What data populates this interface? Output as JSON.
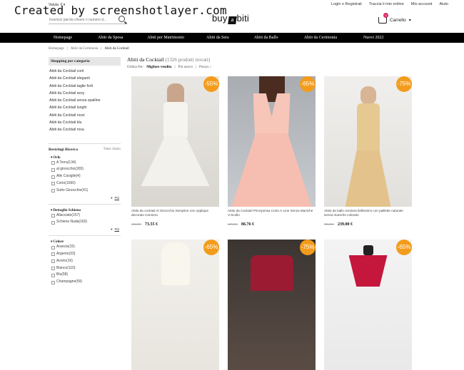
{
  "watermark": "Created by screenshotlayer.com",
  "header": {
    "currency_label": "Valuta: € ▾",
    "search_placeholder": "Inserisci parola chiave o numero d...",
    "logo_pre": "buy",
    "logo_mark": "a",
    "logo_post": "biti",
    "links": [
      "Login o Registrati",
      "Traccia il mio ordine",
      "Mio account",
      "Aiuto"
    ],
    "cart_label": "Carrello",
    "cart_count": "0"
  },
  "nav": [
    "Homepage",
    "Abiti da Sposa",
    "Abiti per Matrimonio",
    "Abiti da Sera",
    "Abiti da Ballo",
    "Abiti da Cerimonia",
    "Nuovi 2022"
  ],
  "breadcrumb": [
    "Homepage",
    "Abiti da Cerimonia",
    "Abiti da Cocktail"
  ],
  "sidebar": {
    "heading": "Shopping per categoria",
    "categories": [
      "Abiti da Cocktail corti",
      "Abiti da Cocktail eleganti",
      "Abiti da Cocktail taglie forti",
      "Abiti da Cocktail sexy",
      "Abiti da Cocktail senza spalline",
      "Abiti da Cocktail lunghi",
      "Abiti da Cocktail rossi",
      "Abiti da Cocktail blu",
      "Abiti da Cocktail rosa"
    ],
    "refine_title": "Restringi Ricerca",
    "refine_clear": "Tutto chiaro",
    "filters": [
      {
        "title": "Orlo",
        "options": [
          "A Terra(134)",
          "al ginocchio(265)",
          "Alle Caviglie(4)",
          "Corto(1060)",
          "Sotto Ginocchio(41)"
        ]
      },
      {
        "title": "Dettaglio Schiena",
        "options": [
          "Allacciato(157)",
          "Schiena Nuda(160)"
        ]
      },
      {
        "title": "Colore",
        "options": [
          "Arancia(15)",
          "Argento(33)",
          "Avorio(16)",
          "Bianco(110)",
          "Blu(58)",
          "Champagne(59)"
        ]
      }
    ],
    "more_label": "Più"
  },
  "main": {
    "title": "Abiti da Cocktail",
    "count": "(1326 prodotti trovati)",
    "sort_label": "Ordina Per:",
    "sort_options": [
      "Migliore vendita",
      "Più nuovo",
      "Prezzo"
    ],
    "sort_sep": "|",
    "price_arrow": "↕"
  },
  "products": [
    {
      "discount": "-55%",
      "name": "Abito da cocktail Al Ginocchio Semplice con Applique decorato Cerniera",
      "old_price": "163,49 €",
      "price": "73.55 €",
      "color": "#f4f1ec"
    },
    {
      "discount": "-65%",
      "name": "Abito da Cocktail Principessa Corto A-Line Senza Maniche V-Scollo",
      "old_price": "247,03 €",
      "price": "86.76 €",
      "color": "#f5c1b6"
    },
    {
      "discount": "-75%",
      "name": "Abito da ballo cerniera bellissimo con paillette naturale senza maniche colorato",
      "old_price": "956,00 €",
      "price": "239.00 €",
      "color": "#e8cfa0"
    },
    {
      "discount": "-65%",
      "name": "",
      "old_price": "",
      "price": "",
      "color": "#f7f3ea"
    },
    {
      "discount": "-75%",
      "name": "",
      "old_price": "",
      "price": "",
      "color": "#9c1b34"
    },
    {
      "discount": "-65%",
      "name": "",
      "old_price": "",
      "price": "",
      "color": "#c8173e"
    }
  ]
}
